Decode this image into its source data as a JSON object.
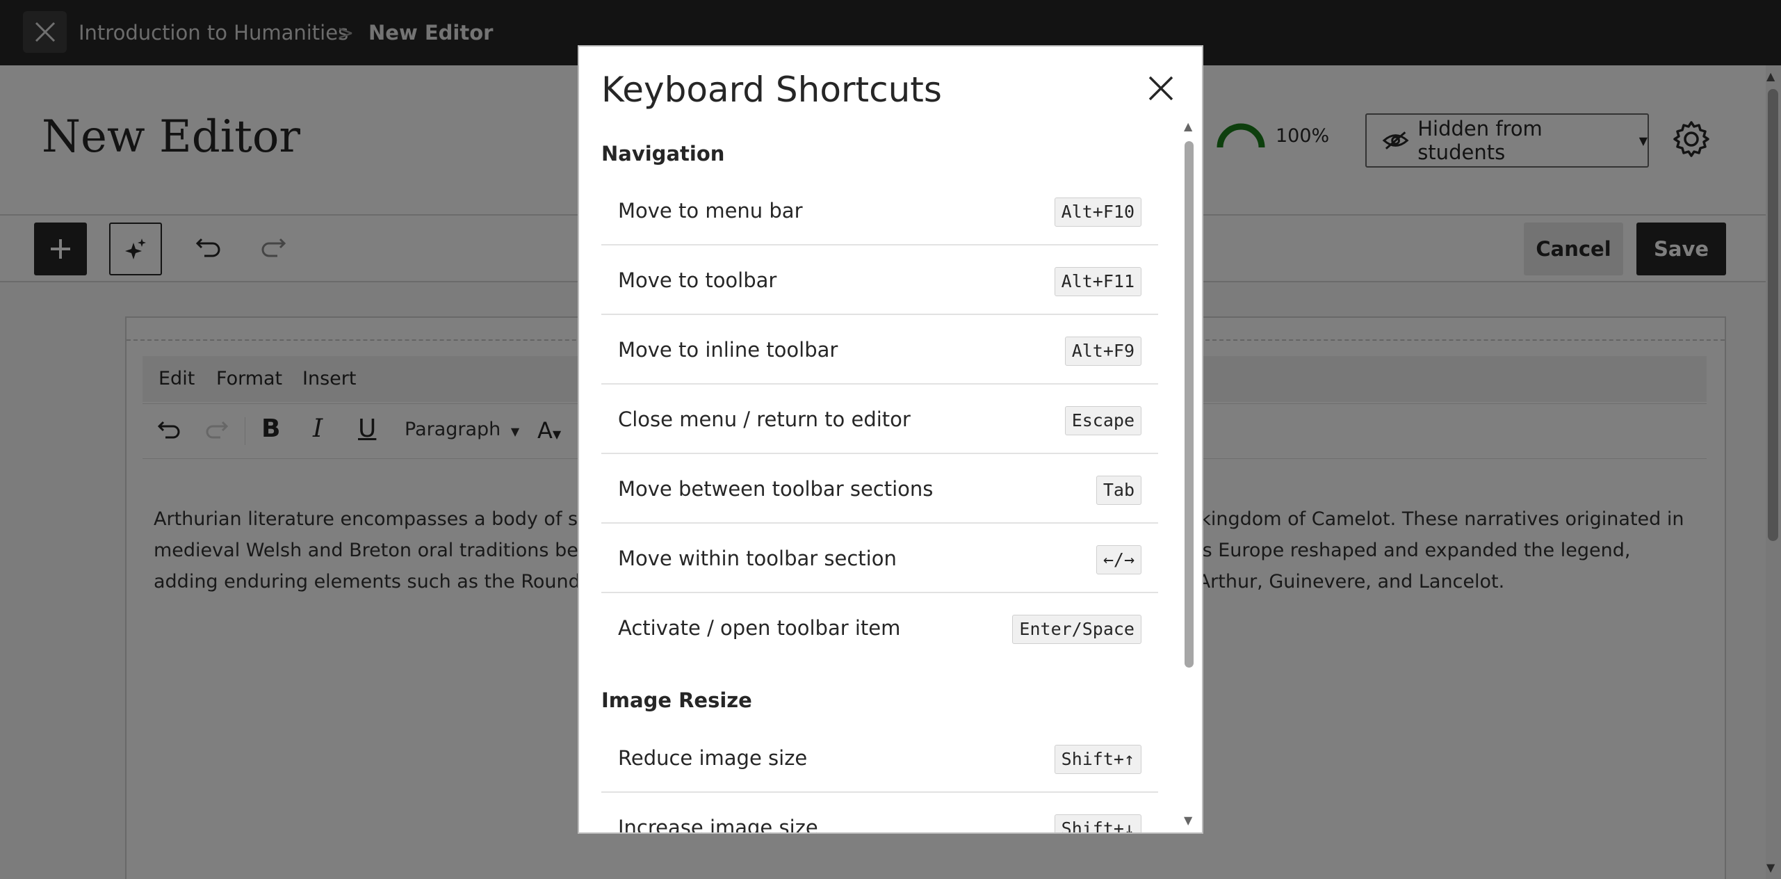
{
  "topbar": {
    "breadcrumb_course": "Introduction to Humanities",
    "breadcrumb_separator": ">",
    "breadcrumb_current": "New Editor"
  },
  "header": {
    "title": "New Editor",
    "progress_text": "100%",
    "progress_value": 1.0,
    "visibility_label": "Hidden from students"
  },
  "toolbar": {
    "cancel_label": "Cancel",
    "save_label": "Save"
  },
  "editor": {
    "menu": [
      "Edit",
      "Format",
      "Insert"
    ],
    "block_format": "Paragraph",
    "body_lines": [
      "Arthurian literature encompasses a body of sto",
      "medieval Welsh and Breton oral traditions befo",
      "adding enduring elements such as the Round T"
    ],
    "body_lines_right": [
      "e kingdom of Camelot. These narratives originated in",
      "oss Europe reshaped and expanded the legend,",
      "n Arthur, Guinevere, and Lancelot."
    ]
  },
  "modal": {
    "title": "Keyboard Shortcuts",
    "sections": [
      {
        "heading": "Navigation",
        "rows": [
          {
            "label": "Move to menu bar",
            "key": "Alt+F10"
          },
          {
            "label": "Move to toolbar",
            "key": "Alt+F11"
          },
          {
            "label": "Move to inline toolbar",
            "key": "Alt+F9"
          },
          {
            "label": "Close menu / return to editor",
            "key": "Escape"
          },
          {
            "label": "Move between toolbar sections",
            "key": "Tab"
          },
          {
            "label": "Move within toolbar section",
            "key": "←/→"
          },
          {
            "label": "Activate / open toolbar item",
            "key": "Enter/Space"
          }
        ]
      },
      {
        "heading": "Image Resize",
        "rows": [
          {
            "label": "Reduce image size",
            "key": "Shift+↑"
          },
          {
            "label": "Increase image size",
            "key": "Shift+↓"
          }
        ]
      }
    ]
  },
  "colors": {
    "topbar": "#262626",
    "progress_green": "#1a7f1a",
    "primary_button": "#262626"
  }
}
